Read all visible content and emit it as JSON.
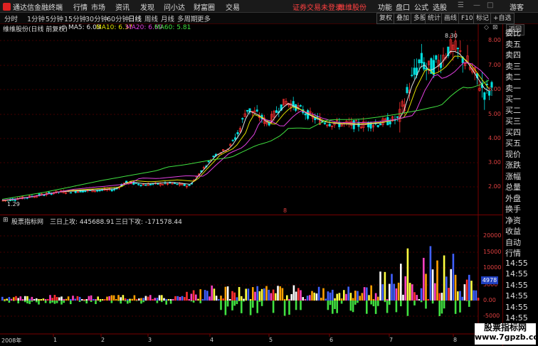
{
  "titlebar": {
    "app_name": "通达信金融终端",
    "menus": [
      "行情",
      "市场",
      "资讯",
      "发现",
      "问小达",
      "财富圈",
      "交易"
    ],
    "notice": "证券交易未登录",
    "stock_name": "维维股份",
    "right_menus": [
      "功能",
      "盘口",
      "公式",
      "选股"
    ],
    "guest": "游客"
  },
  "toolbar": {
    "periods": [
      "分时",
      "1分钟",
      "5分钟",
      "15分钟",
      "30分钟",
      "60分钟",
      "日线",
      "周线",
      "月线",
      "多周期",
      "更多"
    ],
    "active_period": "日线",
    "right_buttons": [
      "复权",
      "叠加",
      "多股",
      "统计",
      "画线",
      "F10",
      "标记",
      "+自选",
      "返回"
    ]
  },
  "legend": {
    "title": "维维股份(日线 前复权)",
    "ma5": "MA5: 6.03",
    "ma10": "MA10: 6.37",
    "ma20": "MA20: 6.69",
    "ma60": "MA60: 5.81"
  },
  "sidebar": {
    "items": [
      "委比",
      "卖五",
      "卖四",
      "卖三",
      "卖二",
      "卖一",
      "买一",
      "买二",
      "买三",
      "买四",
      "买五",
      "现价",
      "涨跌",
      "涨幅",
      "总量",
      "外盘",
      "换手",
      "净资",
      "收益",
      "自动",
      "行情",
      "14:55",
      "14:55",
      "14:55",
      "14:55",
      "14:55",
      "14:55",
      "14:55"
    ]
  },
  "price_axis": [
    "8.00",
    "7.00",
    "6.00",
    "5.00",
    "4.00",
    "3.00",
    "2.00"
  ],
  "annotations": {
    "high": "8.30",
    "low": "1.29",
    "marker": "8"
  },
  "indicator": {
    "name": "股票指标网",
    "up_label": "三日上攻: 445688.91",
    "down_label": "三日下攻: -171578.44",
    "axis": [
      "20000",
      "15000",
      "10000",
      "5000",
      "0.00",
      "-5000"
    ],
    "current": "4978"
  },
  "x_axis": [
    "2008年",
    "1",
    "2",
    "3",
    "4",
    "5",
    "6",
    "7",
    "8"
  ],
  "watermark": {
    "line1": "股票指标网",
    "line2": "www.7gpzb.com"
  },
  "colors": {
    "up": "#ff3030",
    "down": "#00e0e0",
    "ma5": "#e0e0e0",
    "ma10": "#e0e000",
    "ma20": "#e040e0",
    "ma60": "#40e040"
  }
}
